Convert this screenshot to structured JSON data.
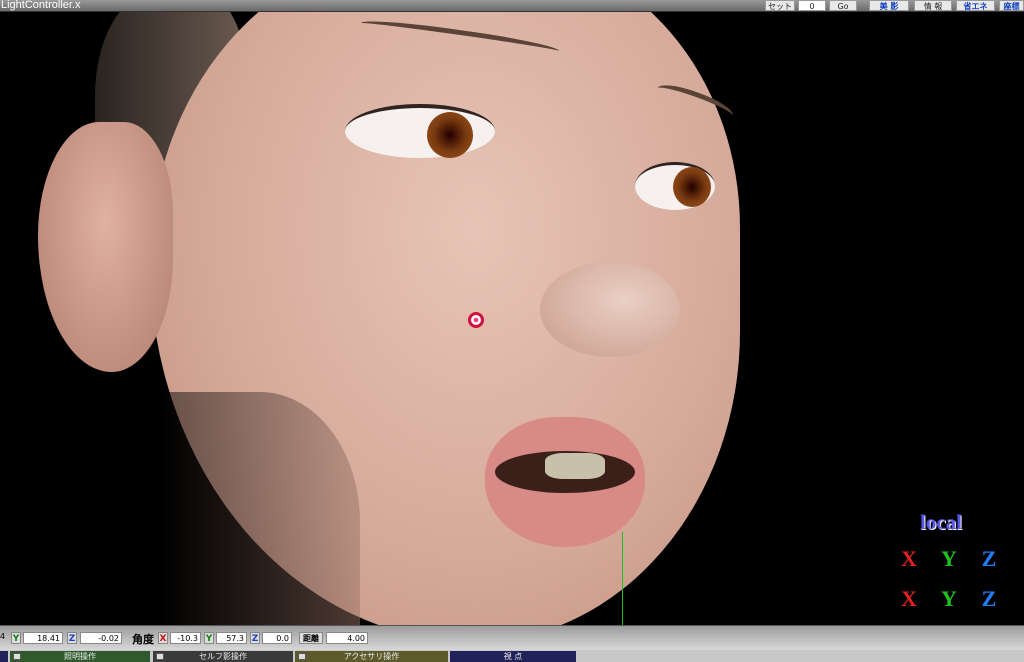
{
  "window": {
    "title": "LightController.x"
  },
  "toolbar": {
    "set_label": "セット",
    "frame_value": "0",
    "go_label": "Go",
    "bikage_label": "美 影",
    "info_label": "情 報",
    "eco_label": "省エネ",
    "coord_label": "座標"
  },
  "viewport": {
    "mode_label": "local",
    "rotate_buttons": [
      "X",
      "Y",
      "Z"
    ],
    "move_buttons": [
      "X",
      "Y",
      "Z"
    ],
    "axis_colors": {
      "x": "#e02020",
      "y": "#20c020",
      "z": "#2080ff"
    }
  },
  "position": {
    "cut_label": "4",
    "y_label": "Y",
    "y_value": "18.41",
    "z_label": "Z",
    "z_value": "-0.02"
  },
  "angle": {
    "label": "角度",
    "x_label": "X",
    "x_value": "-10.3",
    "y_label": "Y",
    "y_value": "57.3",
    "z_label": "Z",
    "z_value": "0.0"
  },
  "distance": {
    "label": "距離",
    "value": "4.00"
  },
  "panels": [
    {
      "label": "照明操作",
      "color": "#2e5a2e"
    },
    {
      "label": "セルフ影操作",
      "color": "#3a3a3a"
    },
    {
      "label": "アクセサリ操作",
      "color": "#5c5a2a"
    },
    {
      "label": "視 点",
      "color": "#22225a"
    }
  ]
}
